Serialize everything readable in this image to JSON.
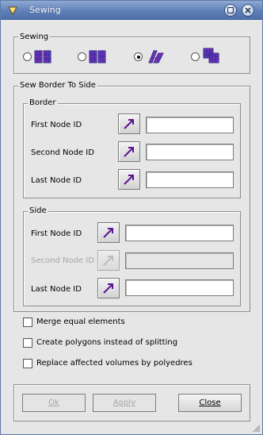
{
  "window": {
    "title": "Sewing"
  },
  "sewing": {
    "legend": "Sewing",
    "options": [
      {
        "icon": "sew-free-borders-icon",
        "checked": false
      },
      {
        "icon": "sew-conform-free-borders-icon",
        "checked": false
      },
      {
        "icon": "sew-border-to-side-icon",
        "checked": true
      },
      {
        "icon": "sew-side-elements-icon",
        "checked": false
      }
    ]
  },
  "sew_border": {
    "legend": "Sew Border To Side",
    "border": {
      "legend": "Border",
      "rows": [
        {
          "label": "First Node ID",
          "value": "",
          "enabled": true
        },
        {
          "label": "Second Node ID",
          "value": "",
          "enabled": true
        },
        {
          "label": "Last Node ID",
          "value": "",
          "enabled": true
        }
      ]
    },
    "side": {
      "legend": "Side",
      "rows": [
        {
          "label": "First Node ID",
          "value": "",
          "enabled": true
        },
        {
          "label": "Second Node ID",
          "value": "",
          "enabled": false
        },
        {
          "label": "Last Node ID",
          "value": "",
          "enabled": true
        }
      ]
    }
  },
  "options": [
    {
      "label": "Merge equal elements",
      "checked": false
    },
    {
      "label": "Create polygons instead of splitting",
      "checked": false
    },
    {
      "label": "Replace affected volumes by polyedres",
      "checked": false
    }
  ],
  "buttons": {
    "ok": "Ok",
    "apply": "Apply",
    "close": "Close"
  },
  "colors": {
    "titlebar": "#5f80b8",
    "mesh_purple": "#6a1a9a",
    "mesh_blue": "#1f2fa8"
  }
}
